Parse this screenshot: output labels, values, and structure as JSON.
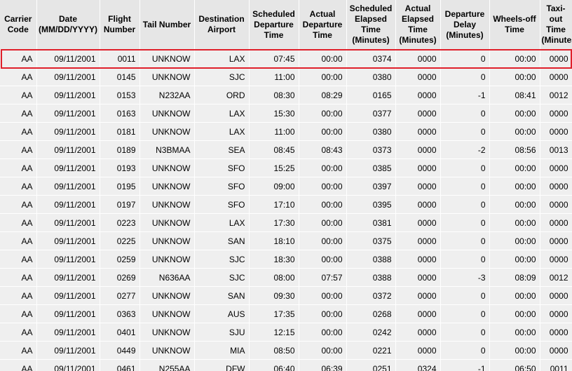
{
  "table": {
    "columns": [
      "Carrier Code",
      "Date (MM/DD/YYYY)",
      "Flight Number",
      "Tail Number",
      "Destination Airport",
      "Scheduled Departure Time",
      "Actual Departure Time",
      "Scheduled Elapsed Time (Minutes)",
      "Actual Elapsed Time (Minutes)",
      "Departure Delay (Minutes)",
      "Wheels-off Time",
      "Taxi-out Time (Minutes)"
    ],
    "rows": [
      [
        "AA",
        "09/11/2001",
        "0011",
        "UNKNOW",
        "LAX",
        "07:45",
        "00:00",
        "0374",
        "0000",
        "0",
        "00:00",
        "0000"
      ],
      [
        "AA",
        "09/11/2001",
        "0145",
        "UNKNOW",
        "SJC",
        "11:00",
        "00:00",
        "0380",
        "0000",
        "0",
        "00:00",
        "0000"
      ],
      [
        "AA",
        "09/11/2001",
        "0153",
        "N232AA",
        "ORD",
        "08:30",
        "08:29",
        "0165",
        "0000",
        "-1",
        "08:41",
        "0012"
      ],
      [
        "AA",
        "09/11/2001",
        "0163",
        "UNKNOW",
        "LAX",
        "15:30",
        "00:00",
        "0377",
        "0000",
        "0",
        "00:00",
        "0000"
      ],
      [
        "AA",
        "09/11/2001",
        "0181",
        "UNKNOW",
        "LAX",
        "11:00",
        "00:00",
        "0380",
        "0000",
        "0",
        "00:00",
        "0000"
      ],
      [
        "AA",
        "09/11/2001",
        "0189",
        "N3BMAA",
        "SEA",
        "08:45",
        "08:43",
        "0373",
        "0000",
        "-2",
        "08:56",
        "0013"
      ],
      [
        "AA",
        "09/11/2001",
        "0193",
        "UNKNOW",
        "SFO",
        "15:25",
        "00:00",
        "0385",
        "0000",
        "0",
        "00:00",
        "0000"
      ],
      [
        "AA",
        "09/11/2001",
        "0195",
        "UNKNOW",
        "SFO",
        "09:00",
        "00:00",
        "0397",
        "0000",
        "0",
        "00:00",
        "0000"
      ],
      [
        "AA",
        "09/11/2001",
        "0197",
        "UNKNOW",
        "SFO",
        "17:10",
        "00:00",
        "0395",
        "0000",
        "0",
        "00:00",
        "0000"
      ],
      [
        "AA",
        "09/11/2001",
        "0223",
        "UNKNOW",
        "LAX",
        "17:30",
        "00:00",
        "0381",
        "0000",
        "0",
        "00:00",
        "0000"
      ],
      [
        "AA",
        "09/11/2001",
        "0225",
        "UNKNOW",
        "SAN",
        "18:10",
        "00:00",
        "0375",
        "0000",
        "0",
        "00:00",
        "0000"
      ],
      [
        "AA",
        "09/11/2001",
        "0259",
        "UNKNOW",
        "SJC",
        "18:30",
        "00:00",
        "0388",
        "0000",
        "0",
        "00:00",
        "0000"
      ],
      [
        "AA",
        "09/11/2001",
        "0269",
        "N636AA",
        "SJC",
        "08:00",
        "07:57",
        "0388",
        "0000",
        "-3",
        "08:09",
        "0012"
      ],
      [
        "AA",
        "09/11/2001",
        "0277",
        "UNKNOW",
        "SAN",
        "09:30",
        "00:00",
        "0372",
        "0000",
        "0",
        "00:00",
        "0000"
      ],
      [
        "AA",
        "09/11/2001",
        "0363",
        "UNKNOW",
        "AUS",
        "17:35",
        "00:00",
        "0268",
        "0000",
        "0",
        "00:00",
        "0000"
      ],
      [
        "AA",
        "09/11/2001",
        "0401",
        "UNKNOW",
        "SJU",
        "12:15",
        "00:00",
        "0242",
        "0000",
        "0",
        "00:00",
        "0000"
      ],
      [
        "AA",
        "09/11/2001",
        "0449",
        "UNKNOW",
        "MIA",
        "08:50",
        "00:00",
        "0221",
        "0000",
        "0",
        "00:00",
        "0000"
      ],
      [
        "AA",
        "09/11/2001",
        "0461",
        "N255AA",
        "DFW",
        "06:40",
        "06:39",
        "0251",
        "0324",
        "-1",
        "06:50",
        "0011"
      ]
    ],
    "highlight_color": "#e0202b"
  }
}
